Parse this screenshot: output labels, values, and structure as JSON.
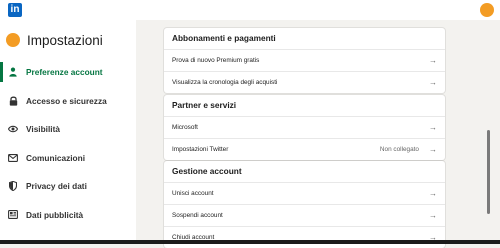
{
  "app": {
    "logo_text": "in"
  },
  "sidebar": {
    "title": "Impostazioni",
    "items": [
      {
        "label": "Preferenze account",
        "icon": "person-icon",
        "active": true
      },
      {
        "label": "Accesso e sicurezza",
        "icon": "lock-icon",
        "active": false
      },
      {
        "label": "Visibilità",
        "icon": "eye-icon",
        "active": false
      },
      {
        "label": "Comunicazioni",
        "icon": "envelope-icon",
        "active": false
      },
      {
        "label": "Privacy dei dati",
        "icon": "shield-icon",
        "active": false
      },
      {
        "label": "Dati pubblicità",
        "icon": "newspaper-icon",
        "active": false
      }
    ]
  },
  "sections": [
    {
      "title": "Abbonamenti e pagamenti",
      "rows": [
        {
          "label": "Prova di nuovo Premium gratis",
          "value": ""
        },
        {
          "label": "Visualizza la cronologia degli acquisti",
          "value": ""
        }
      ]
    },
    {
      "title": "Partner e servizi",
      "rows": [
        {
          "label": "Microsoft",
          "value": ""
        },
        {
          "label": "Impostazioni Twitter",
          "value": "Non collegato"
        }
      ]
    },
    {
      "title": "Gestione account",
      "rows": [
        {
          "label": "Unisci account",
          "value": ""
        },
        {
          "label": "Sospendi account",
          "value": ""
        },
        {
          "label": "Chiudi account",
          "value": ""
        }
      ]
    }
  ],
  "arrow_glyph": "→",
  "colors": {
    "brand": "#0a66c2",
    "active": "#057642",
    "avatar": "#f39c24"
  }
}
